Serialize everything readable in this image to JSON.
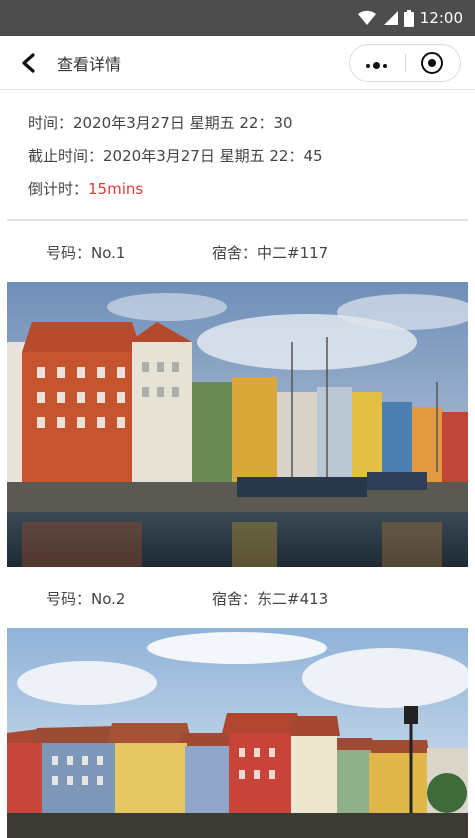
{
  "status_bar": {
    "time": "12:00"
  },
  "nav": {
    "title": "查看详情"
  },
  "info": {
    "time_label": "时间：",
    "time_value": "2020年3月27日  星期五  22：30",
    "deadline_label": "截止时间：",
    "deadline_value": "2020年3月27日 星期五  22：45",
    "countdown_label": "倒计时：",
    "countdown_value": "15mins"
  },
  "entries": [
    {
      "number_label": "号码：",
      "number": "No.1",
      "dorm_label": "宿舍：",
      "dorm": "中二#117"
    },
    {
      "number_label": "号码：",
      "number": "No.2",
      "dorm_label": "宿舍：",
      "dorm": "东二#413"
    }
  ],
  "colors": {
    "countdown": "#e53935",
    "status_bar": "#4d4d4d"
  }
}
